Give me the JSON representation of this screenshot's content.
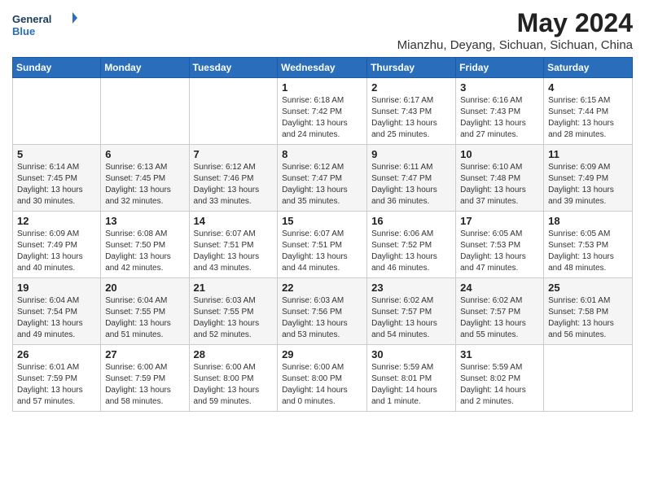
{
  "header": {
    "logo_line1": "General",
    "logo_line2": "Blue",
    "month_year": "May 2024",
    "location": "Mianzhu, Deyang, Sichuan, Sichuan, China"
  },
  "days_of_week": [
    "Sunday",
    "Monday",
    "Tuesday",
    "Wednesday",
    "Thursday",
    "Friday",
    "Saturday"
  ],
  "weeks": [
    [
      {
        "day": "",
        "info": ""
      },
      {
        "day": "",
        "info": ""
      },
      {
        "day": "",
        "info": ""
      },
      {
        "day": "1",
        "info": "Sunrise: 6:18 AM\nSunset: 7:42 PM\nDaylight: 13 hours\nand 24 minutes."
      },
      {
        "day": "2",
        "info": "Sunrise: 6:17 AM\nSunset: 7:43 PM\nDaylight: 13 hours\nand 25 minutes."
      },
      {
        "day": "3",
        "info": "Sunrise: 6:16 AM\nSunset: 7:43 PM\nDaylight: 13 hours\nand 27 minutes."
      },
      {
        "day": "4",
        "info": "Sunrise: 6:15 AM\nSunset: 7:44 PM\nDaylight: 13 hours\nand 28 minutes."
      }
    ],
    [
      {
        "day": "5",
        "info": "Sunrise: 6:14 AM\nSunset: 7:45 PM\nDaylight: 13 hours\nand 30 minutes."
      },
      {
        "day": "6",
        "info": "Sunrise: 6:13 AM\nSunset: 7:45 PM\nDaylight: 13 hours\nand 32 minutes."
      },
      {
        "day": "7",
        "info": "Sunrise: 6:12 AM\nSunset: 7:46 PM\nDaylight: 13 hours\nand 33 minutes."
      },
      {
        "day": "8",
        "info": "Sunrise: 6:12 AM\nSunset: 7:47 PM\nDaylight: 13 hours\nand 35 minutes."
      },
      {
        "day": "9",
        "info": "Sunrise: 6:11 AM\nSunset: 7:47 PM\nDaylight: 13 hours\nand 36 minutes."
      },
      {
        "day": "10",
        "info": "Sunrise: 6:10 AM\nSunset: 7:48 PM\nDaylight: 13 hours\nand 37 minutes."
      },
      {
        "day": "11",
        "info": "Sunrise: 6:09 AM\nSunset: 7:49 PM\nDaylight: 13 hours\nand 39 minutes."
      }
    ],
    [
      {
        "day": "12",
        "info": "Sunrise: 6:09 AM\nSunset: 7:49 PM\nDaylight: 13 hours\nand 40 minutes."
      },
      {
        "day": "13",
        "info": "Sunrise: 6:08 AM\nSunset: 7:50 PM\nDaylight: 13 hours\nand 42 minutes."
      },
      {
        "day": "14",
        "info": "Sunrise: 6:07 AM\nSunset: 7:51 PM\nDaylight: 13 hours\nand 43 minutes."
      },
      {
        "day": "15",
        "info": "Sunrise: 6:07 AM\nSunset: 7:51 PM\nDaylight: 13 hours\nand 44 minutes."
      },
      {
        "day": "16",
        "info": "Sunrise: 6:06 AM\nSunset: 7:52 PM\nDaylight: 13 hours\nand 46 minutes."
      },
      {
        "day": "17",
        "info": "Sunrise: 6:05 AM\nSunset: 7:53 PM\nDaylight: 13 hours\nand 47 minutes."
      },
      {
        "day": "18",
        "info": "Sunrise: 6:05 AM\nSunset: 7:53 PM\nDaylight: 13 hours\nand 48 minutes."
      }
    ],
    [
      {
        "day": "19",
        "info": "Sunrise: 6:04 AM\nSunset: 7:54 PM\nDaylight: 13 hours\nand 49 minutes."
      },
      {
        "day": "20",
        "info": "Sunrise: 6:04 AM\nSunset: 7:55 PM\nDaylight: 13 hours\nand 51 minutes."
      },
      {
        "day": "21",
        "info": "Sunrise: 6:03 AM\nSunset: 7:55 PM\nDaylight: 13 hours\nand 52 minutes."
      },
      {
        "day": "22",
        "info": "Sunrise: 6:03 AM\nSunset: 7:56 PM\nDaylight: 13 hours\nand 53 minutes."
      },
      {
        "day": "23",
        "info": "Sunrise: 6:02 AM\nSunset: 7:57 PM\nDaylight: 13 hours\nand 54 minutes."
      },
      {
        "day": "24",
        "info": "Sunrise: 6:02 AM\nSunset: 7:57 PM\nDaylight: 13 hours\nand 55 minutes."
      },
      {
        "day": "25",
        "info": "Sunrise: 6:01 AM\nSunset: 7:58 PM\nDaylight: 13 hours\nand 56 minutes."
      }
    ],
    [
      {
        "day": "26",
        "info": "Sunrise: 6:01 AM\nSunset: 7:59 PM\nDaylight: 13 hours\nand 57 minutes."
      },
      {
        "day": "27",
        "info": "Sunrise: 6:00 AM\nSunset: 7:59 PM\nDaylight: 13 hours\nand 58 minutes."
      },
      {
        "day": "28",
        "info": "Sunrise: 6:00 AM\nSunset: 8:00 PM\nDaylight: 13 hours\nand 59 minutes."
      },
      {
        "day": "29",
        "info": "Sunrise: 6:00 AM\nSunset: 8:00 PM\nDaylight: 14 hours\nand 0 minutes."
      },
      {
        "day": "30",
        "info": "Sunrise: 5:59 AM\nSunset: 8:01 PM\nDaylight: 14 hours\nand 1 minute."
      },
      {
        "day": "31",
        "info": "Sunrise: 5:59 AM\nSunset: 8:02 PM\nDaylight: 14 hours\nand 2 minutes."
      },
      {
        "day": "",
        "info": ""
      }
    ]
  ]
}
